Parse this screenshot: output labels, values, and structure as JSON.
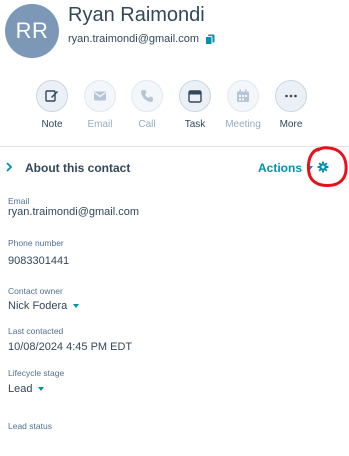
{
  "contact": {
    "initials": "RR",
    "name": "Ryan Raimondi",
    "email": "ryan.traimondi@gmail.com"
  },
  "actions": [
    {
      "label": "Note",
      "icon": "note-icon",
      "enabled": true
    },
    {
      "label": "Email",
      "icon": "email-icon",
      "enabled": false
    },
    {
      "label": "Call",
      "icon": "phone-icon",
      "enabled": false
    },
    {
      "label": "Task",
      "icon": "task-icon",
      "enabled": true
    },
    {
      "label": "Meeting",
      "icon": "calendar-icon",
      "enabled": false
    },
    {
      "label": "More",
      "icon": "more-icon",
      "enabled": true
    }
  ],
  "section": {
    "title": "About this contact",
    "actions_label": "Actions",
    "settings_icon": "gear-icon"
  },
  "fields": {
    "email": {
      "label": "Email",
      "value": "ryan.traimondi@gmail.com"
    },
    "phone": {
      "label": "Phone number",
      "value": "9083301441"
    },
    "owner": {
      "label": "Contact owner",
      "value": "Nick Fodera"
    },
    "last_contacted": {
      "label": "Last contacted",
      "value": "10/08/2024 4:45 PM EDT"
    },
    "lifecycle": {
      "label": "Lifecycle stage",
      "value": "Lead"
    },
    "lead_status": {
      "label": "Lead status",
      "value": ""
    }
  },
  "colors": {
    "avatar": "#7c98b6",
    "link": "#0091ae",
    "text": "#33475b",
    "annotation": "#e8101a"
  }
}
